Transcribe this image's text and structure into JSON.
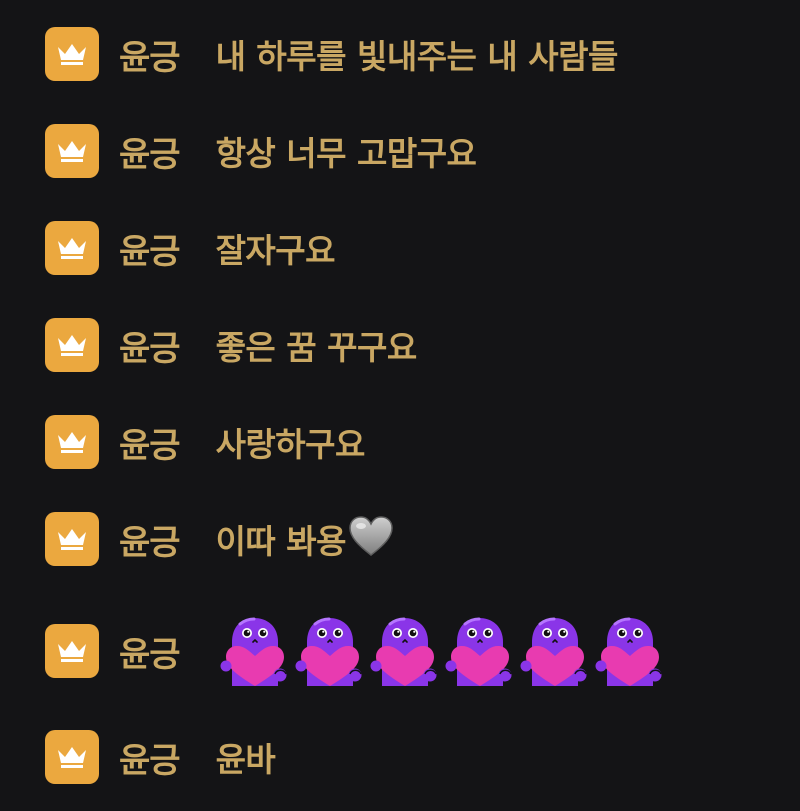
{
  "colors": {
    "background": "#141416",
    "badge": "#EBA83F",
    "text": "#C9A763",
    "emote_body": "#8A35E8",
    "emote_heart": "#E83BB0"
  },
  "badge_icon": "crown-icon",
  "emote_icon": "purple-blob-heart-emote",
  "messages": [
    {
      "user": "윤긍",
      "text": "내 하루를 빛내주는 내 사람들"
    },
    {
      "user": "윤긍",
      "text": "항상 너무 고맙구요"
    },
    {
      "user": "윤긍",
      "text": "잘자구요"
    },
    {
      "user": "윤긍",
      "text": "좋은 꿈 꾸구요"
    },
    {
      "user": "윤긍",
      "text": "사랑하구요"
    },
    {
      "user": "윤긍",
      "text": "이따 봐용",
      "emoji": "grey-heart-icon"
    },
    {
      "user": "윤긍",
      "emote_count": 6
    },
    {
      "user": "윤긍",
      "text": "윤바"
    }
  ]
}
